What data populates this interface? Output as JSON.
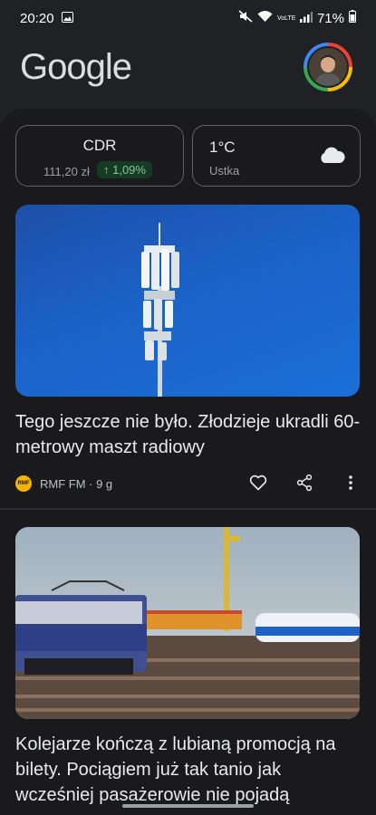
{
  "status": {
    "time": "20:20",
    "battery": "71%",
    "network": "VoLTE"
  },
  "header": {
    "logo": "Google"
  },
  "stock": {
    "symbol": "CDR",
    "price": "111,20 zł",
    "change": "↑ 1,09%"
  },
  "weather": {
    "temp": "1°C",
    "location": "Ustka"
  },
  "articles": [
    {
      "title": "Tego jeszcze nie było. Złodzieje ukradli 60-metrowy maszt radiowy",
      "source_logo": "RMF",
      "source": "RMF FM · 9 g"
    },
    {
      "title": "Kolejarze kończą z lubianą promocją na bilety. Pociągiem już tak tanio jak wcześniej pasażerowie nie pojadą"
    }
  ],
  "colors": {
    "background": "#202124",
    "accent_green": "#81c995",
    "image_blue": "#1b62c8"
  }
}
